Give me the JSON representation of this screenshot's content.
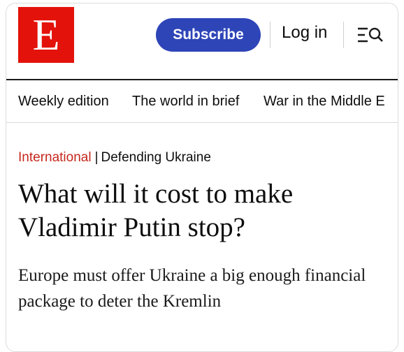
{
  "header": {
    "logo_text": "E",
    "subscribe_label": "Subscribe",
    "login_label": "Log in",
    "menu_icon": "menu-search-icon",
    "brand_color": "#e3120b",
    "subscribe_color": "#2e45b8"
  },
  "nav": {
    "items": [
      {
        "label": "Weekly edition"
      },
      {
        "label": "The world in brief"
      },
      {
        "label": "War in the Middle E"
      }
    ]
  },
  "article": {
    "section": "International",
    "separator": "|",
    "topic": "Defending Ukraine",
    "headline": "What will it cost to make Vladimir Putin stop?",
    "standfirst": "Europe must offer Ukraine a big enough financial package to deter the Kremlin",
    "section_color": "#c6271c"
  }
}
